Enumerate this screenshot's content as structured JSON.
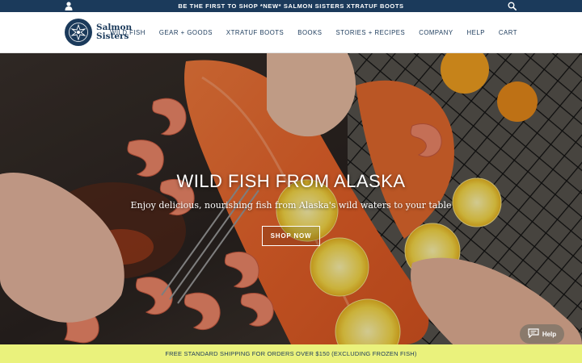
{
  "announcement": {
    "text": "BE THE FIRST TO SHOP *NEW* SALMON SISTERS XTRATUF BOOTS",
    "account_icon": "account-icon",
    "search_icon": "search-icon"
  },
  "brand": {
    "line1": "Salmon",
    "line2": "Sisters",
    "color": "#1b3a5b"
  },
  "nav": {
    "items": [
      {
        "label": "WILD FISH"
      },
      {
        "label": "GEAR + GOODS"
      },
      {
        "label": "XTRATUF BOOTS"
      },
      {
        "label": "BOOKS"
      },
      {
        "label": "STORIES + RECIPES"
      },
      {
        "label": "COMPANY"
      },
      {
        "label": "HELP"
      },
      {
        "label": "CART"
      }
    ]
  },
  "hero": {
    "title": "WILD FISH FROM ALASKA",
    "subtitle": "Enjoy delicious, nourishing fish from Alaska's wild waters to your table",
    "cta": "SHOP NOW"
  },
  "help_widget": {
    "label": "Help",
    "icon": "chat-bubble-icon"
  },
  "shipping_bar": {
    "text": "FREE STANDARD SHIPPING FOR ORDERS OVER $150 (EXCLUDING FROZEN FISH)",
    "color": "#eaf27c"
  }
}
